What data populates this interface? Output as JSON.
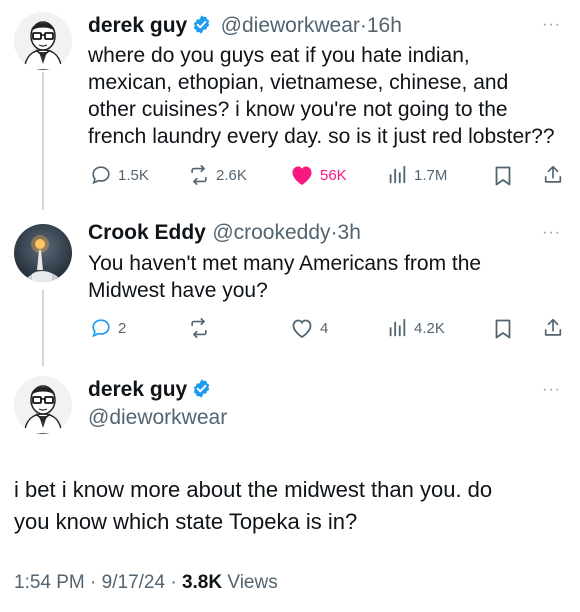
{
  "tweets": [
    {
      "author_name": "derek guy",
      "handle": "@dieworkwear",
      "separator": "·",
      "time": "16h",
      "verified": true,
      "text_lines": [
        "where do you guys eat if you hate indian,",
        "mexican, ethopian, vietnamese, chinese, and",
        "other cuisines? i know you're not going to the",
        "french laundry every day. so is it just red lobster??"
      ],
      "stats": {
        "replies": "1.5K",
        "reposts": "2.6K",
        "likes": "56K",
        "views": "1.7M"
      },
      "liked": true
    },
    {
      "author_name": "Crook Eddy",
      "handle": "@crookeddy",
      "separator": "·",
      "time": "3h",
      "verified": false,
      "text_lines": [
        "You haven't met many Americans from the",
        "Midwest have you?"
      ],
      "stats": {
        "replies": "2",
        "reposts": "",
        "likes": "4",
        "views": "4.2K"
      },
      "liked": false
    }
  ],
  "main_tweet": {
    "author_name": "derek guy",
    "handle": "@dieworkwear",
    "verified": true,
    "text_lines": [
      "i bet i know more about the midwest than you. do",
      "you know which state Topeka is in?"
    ],
    "time": "1:54 PM",
    "sep1": "·",
    "date": "9/17/24",
    "sep2": "·",
    "views_count": "3.8K",
    "views_label": "Views"
  },
  "more_menu_glyph": "···",
  "colors": {
    "text": "#0f1419",
    "secondary": "#536471",
    "verified": "#1d9bf0",
    "like": "#f91880",
    "thread_line": "#cfd9de"
  },
  "icons": [
    "reply-icon",
    "repost-icon",
    "like-icon",
    "views-icon",
    "bookmark-icon",
    "share-icon",
    "verified-badge-icon",
    "more-icon"
  ]
}
